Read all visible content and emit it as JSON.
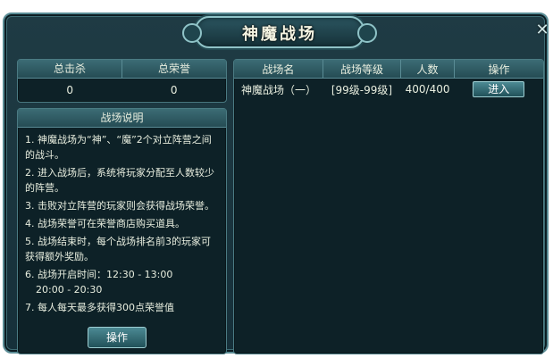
{
  "window": {
    "title": "神魔战场",
    "close_label": "✕"
  },
  "stats": {
    "headers": [
      "总击杀",
      "总荣誉"
    ],
    "values": [
      "0",
      "0"
    ]
  },
  "description": {
    "title": "战场说明",
    "items": [
      "1. 神魔战场为“神”、“魔”2个对立阵营之间的战斗。",
      "2. 进入战场后，系统将玩家分配至人数较少的阵营。",
      "3. 击败对立阵营的玩家则会获得战场荣誉。",
      "4. 战场荣誉可在荣誉商店购买道具。",
      "5. 战场结束时，每个战场排名前3的玩家可获得额外奖励。",
      "6. 战场开启时间：12:30 - 13:00",
      "20:00 - 20:30",
      "7. 每人每天最多获得300点荣誉值"
    ],
    "button_label": "操作"
  },
  "battlefields": {
    "headers": [
      "战场名",
      "战场等级",
      "人数",
      "操作"
    ],
    "rows": [
      {
        "name": "神魔战场（一）",
        "level": "[99级-99级]",
        "count": "400/400",
        "action": "进入"
      }
    ]
  }
}
